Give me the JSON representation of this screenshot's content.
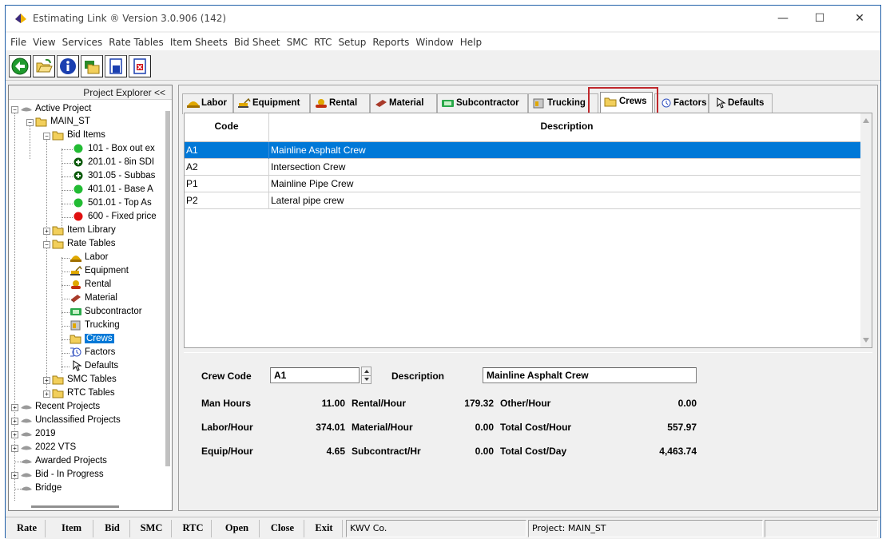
{
  "window": {
    "title": "Estimating Link ® Version  3.0.906 (142)",
    "min_glyph": "—",
    "max_glyph": "☐",
    "close_glyph": "✕"
  },
  "menu": [
    "File",
    "View",
    "Services",
    "Rate Tables",
    "Item Sheets",
    "Bid Sheet",
    "SMC",
    "RTC",
    "Setup",
    "Reports",
    "Window",
    "Help"
  ],
  "explorer": {
    "title": "Project Explorer <<",
    "tree": {
      "active_project": "Active Project",
      "main_st": "MAIN_ST",
      "bid_items": "Bid Items",
      "items": [
        "101 - Box out ex",
        "201.01 - 8in SDI",
        "301.05 - Subbas",
        "401.01 - Base A",
        "501.01 - Top As",
        "600 - Fixed price"
      ],
      "item_library": "Item Library",
      "rate_tables": "Rate Tables",
      "rate_children": [
        "Labor",
        "Equipment",
        "Rental",
        "Material",
        "Subcontractor",
        "Trucking",
        "Crews",
        "Factors",
        "Defaults"
      ],
      "smc_tables": "SMC Tables",
      "rtc_tables": "RTC Tables",
      "root_nodes": [
        "Recent Projects",
        "Unclassified Projects",
        "2019",
        "2022 VTS",
        "Awarded Projects",
        "Bid - In Progress",
        "Bridge"
      ]
    }
  },
  "tabs": [
    "Labor",
    "Equipment",
    "Rental",
    "Material",
    "Subcontractor",
    "Trucking",
    "Crews",
    "Factors",
    "Defaults"
  ],
  "active_tab": "Crews",
  "grid": {
    "columns": [
      "Code",
      "Description"
    ],
    "rows": [
      {
        "code": "A1",
        "description": "Mainline Asphalt Crew"
      },
      {
        "code": "A2",
        "description": "Intersection Crew"
      },
      {
        "code": "P1",
        "description": "Mainline Pipe Crew"
      },
      {
        "code": "P2",
        "description": "Lateral pipe crew"
      }
    ]
  },
  "detail": {
    "crew_code_label": "Crew Code",
    "crew_code_value": "A1",
    "description_label": "Description",
    "description_value": "Mainline Asphalt Crew",
    "man_hours_label": "Man Hours",
    "man_hours_value": "11.00",
    "rental_hour_label": "Rental/Hour",
    "rental_hour_value": "179.32",
    "other_hour_label": "Other/Hour",
    "other_hour_value": "0.00",
    "labor_hour_label": "Labor/Hour",
    "labor_hour_value": "374.01",
    "material_hour_label": "Material/Hour",
    "material_hour_value": "0.00",
    "total_cost_hour_label": "Total Cost/Hour",
    "total_cost_hour_value": "557.97",
    "equip_hour_label": "Equip/Hour",
    "equip_hour_value": "4.65",
    "subcontract_hr_label": "Subcontract/Hr",
    "subcontract_hr_value": "0.00",
    "total_cost_day_label": "Total Cost/Day",
    "total_cost_day_value": "4,463.74"
  },
  "statusbar": {
    "buttons": [
      "Rate",
      "Item",
      "Bid",
      "SMC",
      "RTC",
      "Open",
      "Close",
      "Exit"
    ],
    "company": "KWV Co.",
    "project": "Project: MAIN_ST"
  },
  "colors": {
    "selection": "#0078d7",
    "highlight_box": "#c0282c",
    "status_green": "#22bb33",
    "status_red": "#e01010",
    "folder_yellow": "#f2cf5b"
  }
}
